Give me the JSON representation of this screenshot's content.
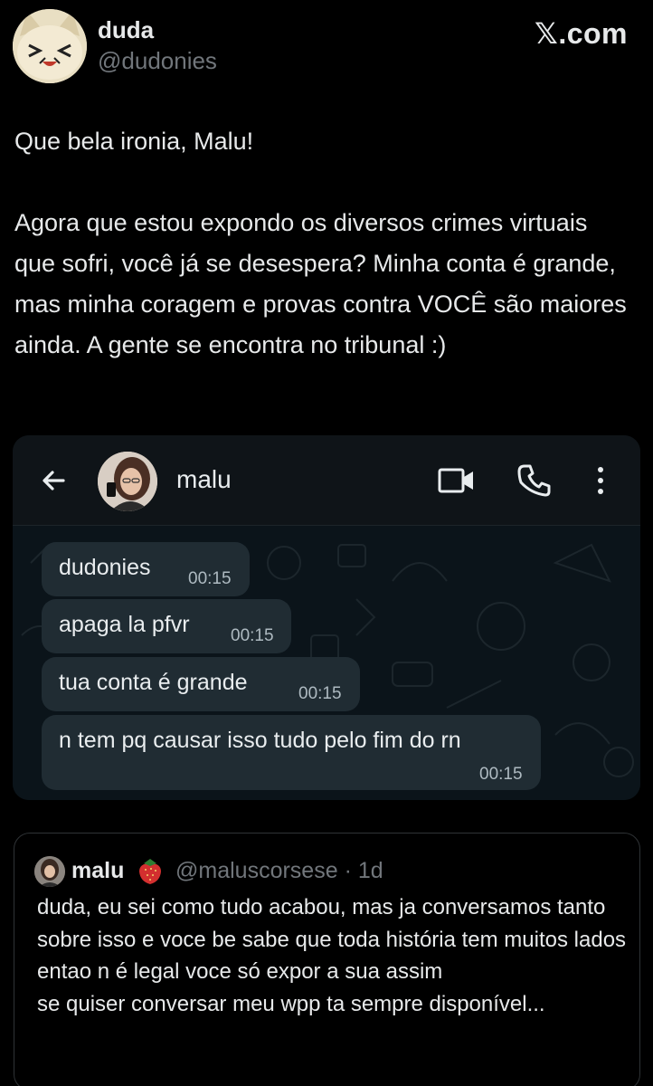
{
  "tweet": {
    "author_name": "duda",
    "author_handle": "@dudonies",
    "brand": "𝕏.com",
    "text": "Que bela ironia, Malu!\n\nAgora que estou expondo os diversos crimes virtuais que sofri, você já se desespera? Minha conta é grande, mas minha coragem e provas contra VOCÊ são maiores ainda. A gente se encontra no tribunal :)"
  },
  "chat": {
    "contact_name": "malu",
    "messages": [
      {
        "text": "dudonies",
        "time": "00:15"
      },
      {
        "text": "apaga la pfvr",
        "time": "00:15"
      },
      {
        "text": "tua conta é grande",
        "time": "00:15"
      },
      {
        "text": "n tem pq causar isso tudo pelo fim do rn",
        "time": "00:15"
      }
    ]
  },
  "quote": {
    "name": "malu",
    "emoji": "strawberry-emoji",
    "handle": "@maluscorsese",
    "meta": "· 1d",
    "text": "duda, eu sei como tudo acabou, mas ja conversamos tanto sobre isso e voce be sabe que toda história tem muitos lados entao n é legal voce só expor a sua assim\nse quiser conversar meu wpp ta sempre disponível..."
  },
  "icons": [
    "back-arrow-icon",
    "video-call-icon",
    "phone-icon",
    "more-vertical-icon"
  ],
  "colors": {
    "background": "#000000",
    "text": "#e7e9ea",
    "muted": "#71767b",
    "chat_bg": "#0b141a",
    "bubble": "#202c33"
  }
}
